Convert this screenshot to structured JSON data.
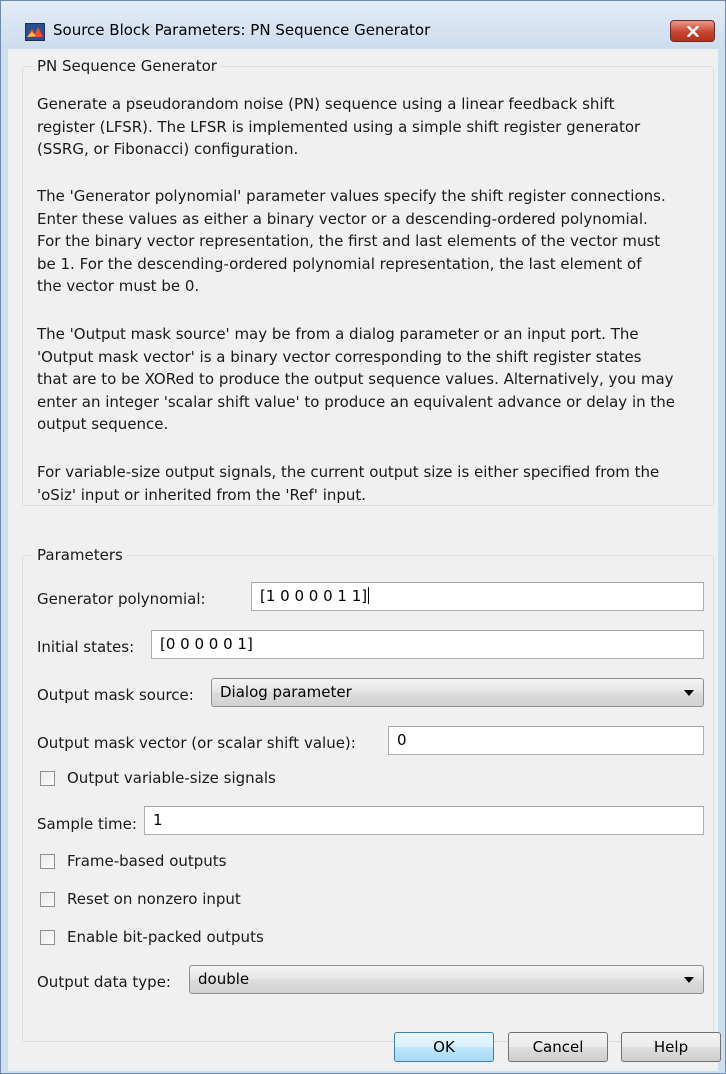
{
  "window": {
    "title": "Source Block Parameters: PN Sequence Generator"
  },
  "description_group": {
    "label": "PN Sequence Generator",
    "paragraphs": [
      [
        "Generate a pseudorandom noise (PN) sequence using a linear feedback shift",
        "register (LFSR). The LFSR is implemented using a simple shift register generator",
        "(SSRG, or Fibonacci) configuration."
      ],
      [
        "The 'Generator polynomial' parameter values specify the shift register connections.",
        "Enter these values as either a binary vector or a descending-ordered polynomial.",
        "For the binary vector representation, the first and last elements of the vector must",
        "be 1. For the descending-ordered polynomial representation, the last element of",
        "the vector must be 0."
      ],
      [
        "The 'Output mask source' may be from a dialog parameter or an input port. The",
        "'Output mask vector' is a binary vector corresponding to the shift register states",
        "that are to be XORed to produce the output sequence values. Alternatively, you may",
        "enter an integer 'scalar shift value' to produce an equivalent advance or delay in the",
        "output sequence."
      ],
      [
        "For variable-size output signals, the current output size is either specified from the",
        "'oSiz' input or inherited from the 'Ref' input."
      ]
    ]
  },
  "parameters": {
    "label": "Parameters",
    "generator_polynomial": {
      "label": "Generator polynomial:",
      "value": "[1 0 0 0 0 1 1]"
    },
    "initial_states": {
      "label": "Initial states:",
      "value": "[0 0 0 0 0 1]"
    },
    "output_mask_source": {
      "label": "Output mask source:",
      "value": "Dialog parameter"
    },
    "output_mask_vector": {
      "label": "Output mask vector (or scalar shift value):",
      "value": "0"
    },
    "variable_size": {
      "label": "Output variable-size signals",
      "checked": false
    },
    "sample_time": {
      "label": "Sample time:",
      "value": "1"
    },
    "frame_based": {
      "label": "Frame-based outputs",
      "checked": false
    },
    "reset_nonzero": {
      "label": "Reset on nonzero input",
      "checked": false
    },
    "bit_packed": {
      "label": "Enable bit-packed outputs",
      "checked": false
    },
    "output_data_type": {
      "label": "Output data type:",
      "value": "double"
    }
  },
  "buttons": {
    "ok": "OK",
    "cancel": "Cancel",
    "help": "Help"
  },
  "colors": {
    "title_bar": "#cddcee",
    "dialog_background": "#f0f0f0",
    "close_button": "#c7452f",
    "default_button_border": "#3c7fb1"
  }
}
